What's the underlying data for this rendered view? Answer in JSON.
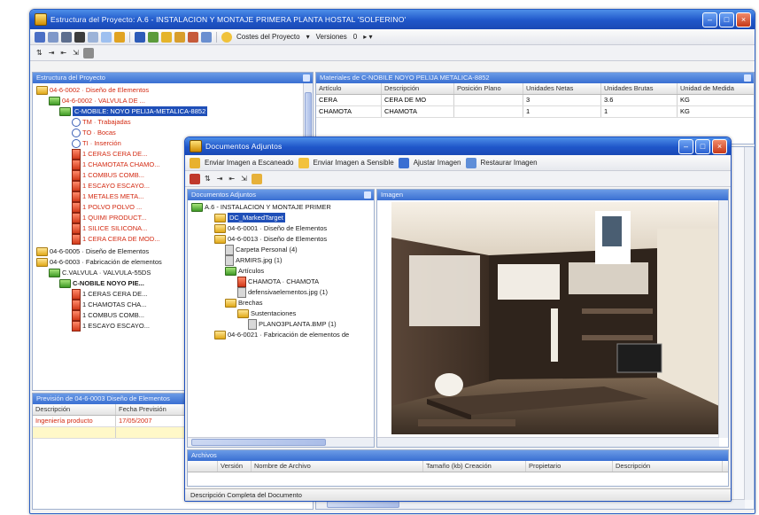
{
  "main_window": {
    "title": "Estructura del Proyecto: A.6 - INSTALACION Y MONTAJE PRIMERA PLANTA HOSTAL 'SOLFERINO'",
    "toolbar": {
      "costs_menu": "Costes del Proyecto",
      "versions_menu": "Versiones",
      "version_value": "0"
    },
    "tree_pane_title": "Estructura del Proyecto",
    "tree_items": [
      {
        "label": "04-6-0002 · Diseño de Elementos",
        "color": "red"
      },
      {
        "label": "04-6-0002 · VALVULA DE ...",
        "color": "red"
      },
      {
        "label": "C-MOBILE: NOYO PELIJA-METALICA-8852",
        "color": "selected"
      },
      {
        "label": "TM · Trabajadas",
        "color": "red"
      },
      {
        "label": "TO · Bocas",
        "color": "red"
      },
      {
        "label": "TI · Inserción",
        "color": "red"
      },
      {
        "label": "1 CERAS CERA DE...",
        "color": "red"
      },
      {
        "label": "1 CHAMOTATA CHAMO...",
        "color": "red"
      },
      {
        "label": "1 COMBUS COMB...",
        "color": "red"
      },
      {
        "label": "1 ESCAYO ESCAYO...",
        "color": "red"
      },
      {
        "label": "1 METALES META...",
        "color": "red"
      },
      {
        "label": "1 POLVO POLVO ...",
        "color": "red"
      },
      {
        "label": "1 QUIMI PRODUCT...",
        "color": "red"
      },
      {
        "label": "1 SILICE SILICONA...",
        "color": "red"
      },
      {
        "label": "1 CERA CERA DE MOD...",
        "color": "red"
      },
      {
        "label": "04-6-0005 · Diseño de Elementos",
        "color": "black"
      },
      {
        "label": "04-6-0003 · Fabricación de elementos",
        "color": "black"
      },
      {
        "label": "C.VALVULA · VALVULA-55DS",
        "color": "black"
      },
      {
        "label": "C-NOBILE NOYO PIE...",
        "color": "black"
      },
      {
        "label": "1 CERAS CERA DE...",
        "color": "black"
      },
      {
        "label": "1 CHAMOTAS CHA...",
        "color": "black"
      },
      {
        "label": "1 COMBUS COMB...",
        "color": "black"
      },
      {
        "label": "1 ESCAYO ESCAYO...",
        "color": "black"
      }
    ],
    "materials_pane_title": "Materiales de C-NOBILE NOYO PELIJA METALICA-8852",
    "materials_columns": [
      "Artículo",
      "Descripción",
      "Posición Plano",
      "Unidades Netas",
      "Unidades Brutas",
      "Unidad de Medida"
    ],
    "materials_rows": [
      [
        "CERA",
        "CERA DE MO",
        "",
        "3",
        "3.6",
        "KG"
      ],
      [
        "CHAMOTA",
        "CHAMOTA",
        "",
        "1",
        "1",
        "KG"
      ]
    ],
    "budget_pane_title": "Previsión de 04-6-0003 Diseño de Elementos",
    "budget_columns": [
      "Descripción",
      "Fecha Previsión"
    ],
    "budget_rows": [
      [
        "Ingeniería producto",
        "17/05/2007"
      ]
    ]
  },
  "attach_window": {
    "title": "Documentos Adjuntos",
    "toolbar": {
      "btn1": "Enviar Imagen a Escaneado",
      "btn2": "Enviar Imagen a Sensible",
      "btn3": "Ajustar Imagen",
      "btn4": "Restaurar Imagen"
    },
    "tree_pane_title": "Documentos Adjuntos",
    "preview_pane_title": "Imagen",
    "tree_items": [
      {
        "label": "A.6 - INSTALACION Y MONTAJE PRIMER",
        "type": "root"
      },
      {
        "label": "DC_MarkedTarget",
        "type": "selected"
      },
      {
        "label": "04-6-0001 · Diseño de Elementos",
        "type": "folder"
      },
      {
        "label": "04-6-0013 · Diseño de Elementos",
        "type": "folder"
      },
      {
        "label": "Carpeta Personal (4)",
        "type": "file"
      },
      {
        "label": "ARMIRS.jpg (1)",
        "type": "file"
      },
      {
        "label": "Artículos",
        "type": "folder"
      },
      {
        "label": "CHAMOTA · CHAMOTA",
        "type": "doc"
      },
      {
        "label": "defensivaelementos.jpg (1)",
        "type": "file"
      },
      {
        "label": "Brechas",
        "type": "folder"
      },
      {
        "label": "Sustentaciones",
        "type": "folder"
      },
      {
        "label": "PLANO3PLANTA.BMP (1)",
        "type": "file"
      },
      {
        "label": "04-6-0021 · Fabricación de elementos de",
        "type": "folder"
      }
    ],
    "bottom_pane_title": "Archivos",
    "bottom_columns": [
      "Versión",
      "Nombre de Archivo",
      "Tamaño (kb) Creación",
      "Propietario",
      "Descripción"
    ],
    "status_text": "Descripción Completa del Documento"
  },
  "colors": {
    "title_blue": "#1f56c9",
    "pane_header_blue": "#3a6fd2",
    "tree_red": "#d32a12",
    "selection": "#1f4fb8"
  }
}
